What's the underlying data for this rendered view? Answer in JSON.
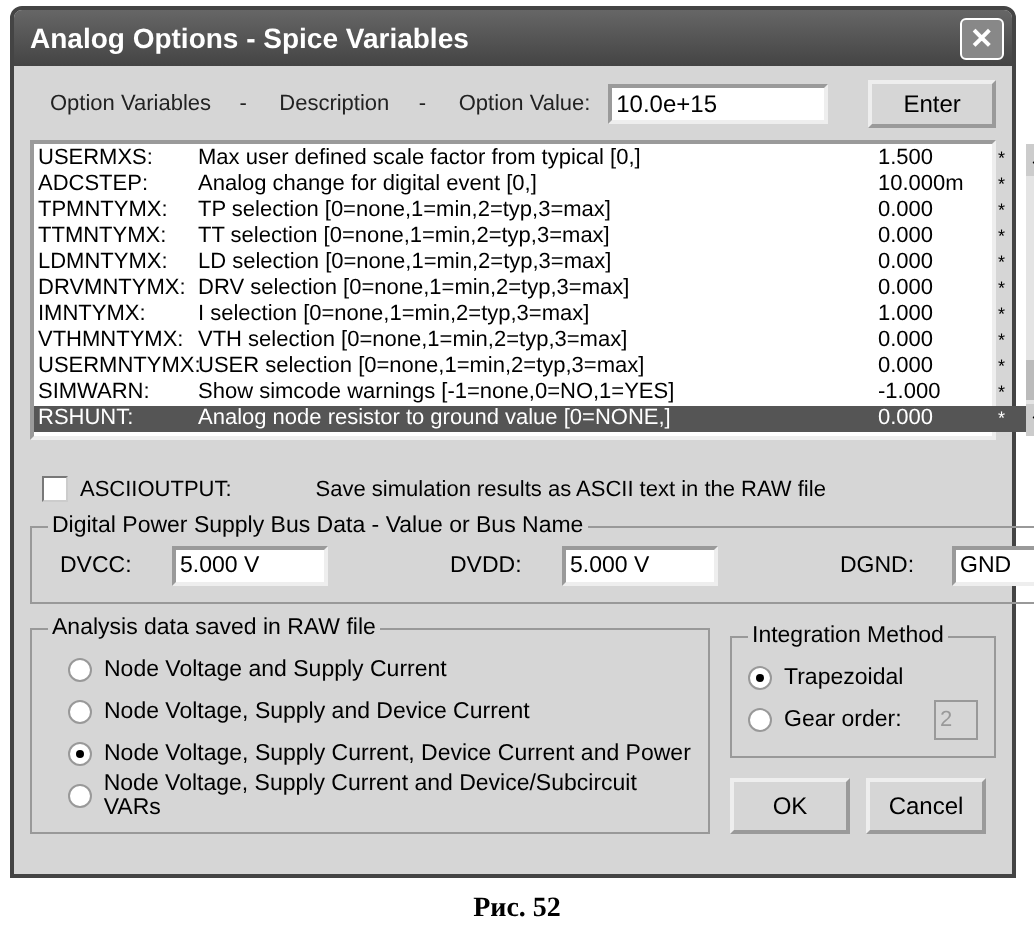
{
  "window": {
    "title": "Analog Options - Spice Variables",
    "close": "✕"
  },
  "header": {
    "col1": "Option Variables",
    "sep1": "-",
    "col2": "Description",
    "sep2": "-",
    "col3": "Option Value:",
    "value": "10.0e+15",
    "button": "Enter"
  },
  "options": [
    {
      "name": "USERMXS:",
      "description": "Max user defined scale factor from typical [0,]",
      "value": "1.500",
      "flag": "*",
      "selected": false
    },
    {
      "name": "ADCSTEP:",
      "description": "Analog change for digital event [0,]",
      "value": "10.000m",
      "flag": "*",
      "selected": false
    },
    {
      "name": "TPMNTYMX:",
      "description": "TP selection [0=none,1=min,2=typ,3=max]",
      "value": "0.000",
      "flag": "*",
      "selected": false
    },
    {
      "name": "TTMNTYMX:",
      "description": "TT selection [0=none,1=min,2=typ,3=max]",
      "value": "0.000",
      "flag": "*",
      "selected": false
    },
    {
      "name": "LDMNTYMX:",
      "description": "LD selection [0=none,1=min,2=typ,3=max]",
      "value": "0.000",
      "flag": "*",
      "selected": false
    },
    {
      "name": "DRVMNTYMX:",
      "description": "DRV selection [0=none,1=min,2=typ,3=max]",
      "value": "0.000",
      "flag": "*",
      "selected": false
    },
    {
      "name": "IMNTYMX:",
      "description": "I selection [0=none,1=min,2=typ,3=max]",
      "value": "1.000",
      "flag": "*",
      "selected": false
    },
    {
      "name": "VTHMNTYMX:",
      "description": "VTH selection [0=none,1=min,2=typ,3=max]",
      "value": "0.000",
      "flag": "*",
      "selected": false
    },
    {
      "name": "USERMNTYMX:",
      "description": "USER selection [0=none,1=min,2=typ,3=max]",
      "value": "0.000",
      "flag": "*",
      "selected": false
    },
    {
      "name": "SIMWARN:",
      "description": "Show simcode warnings [-1=none,0=NO,1=YES]",
      "value": "-1.000",
      "flag": "*",
      "selected": false
    },
    {
      "name": "RSHUNT:",
      "description": "Analog node resistor to ground value [0=NONE,]",
      "value": "0.000",
      "flag": "*",
      "selected": true
    }
  ],
  "ascii": {
    "label": "ASCIIOUTPUT:",
    "checked": false,
    "description": "Save simulation results as ASCII text in the RAW file"
  },
  "power": {
    "title": "Digital Power Supply Bus Data - Value or Bus Name",
    "fields": [
      {
        "label": "DVCC:",
        "value": "5.000 V"
      },
      {
        "label": "DVDD:",
        "value": "5.000 V"
      },
      {
        "label": "DGND:",
        "value": "GND"
      }
    ]
  },
  "analysis": {
    "title": "Analysis data saved in RAW file",
    "options": [
      {
        "label": "Node Voltage and Supply Current",
        "selected": false
      },
      {
        "label": "Node Voltage, Supply and Device Current",
        "selected": false
      },
      {
        "label": "Node Voltage, Supply Current, Device Current and Power",
        "selected": true
      },
      {
        "label": "Node Voltage, Supply Current and Device/Subcircuit VARs",
        "selected": false
      }
    ]
  },
  "integration": {
    "title": "Integration Method",
    "options": [
      {
        "label": "Trapezoidal",
        "selected": true
      },
      {
        "label": "Gear order:",
        "selected": false,
        "value": "2",
        "disabled": true
      }
    ]
  },
  "buttons": [
    "OK",
    "Cancel"
  ],
  "caption": "Рис. 52"
}
